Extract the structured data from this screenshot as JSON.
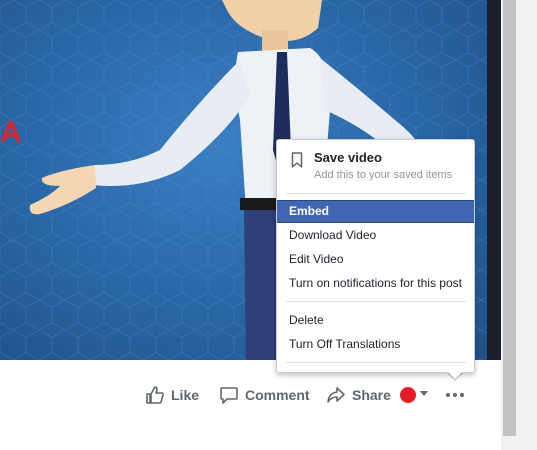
{
  "video": {
    "description_text_visible": "A"
  },
  "menu": {
    "save": {
      "title": "Save video",
      "subtitle": "Add this to your saved items",
      "icon": "bookmark-icon"
    },
    "items": [
      {
        "label": "Embed",
        "active": true
      },
      {
        "label": "Download Video",
        "active": false
      },
      {
        "label": "Edit Video",
        "active": false
      },
      {
        "label": "Turn on notifications for this post",
        "active": false
      },
      {
        "label": "Delete",
        "active": false
      },
      {
        "label": "Turn Off Translations",
        "active": false
      }
    ],
    "active_color": "#4267b2"
  },
  "actions": {
    "like": {
      "label": "Like",
      "icon": "thumbs-up-icon"
    },
    "comment": {
      "label": "Comment",
      "icon": "speech-bubble-icon"
    },
    "share": {
      "label": "Share",
      "icon": "share-arrow-icon"
    },
    "more": {
      "icon": "more-dots-icon"
    }
  }
}
